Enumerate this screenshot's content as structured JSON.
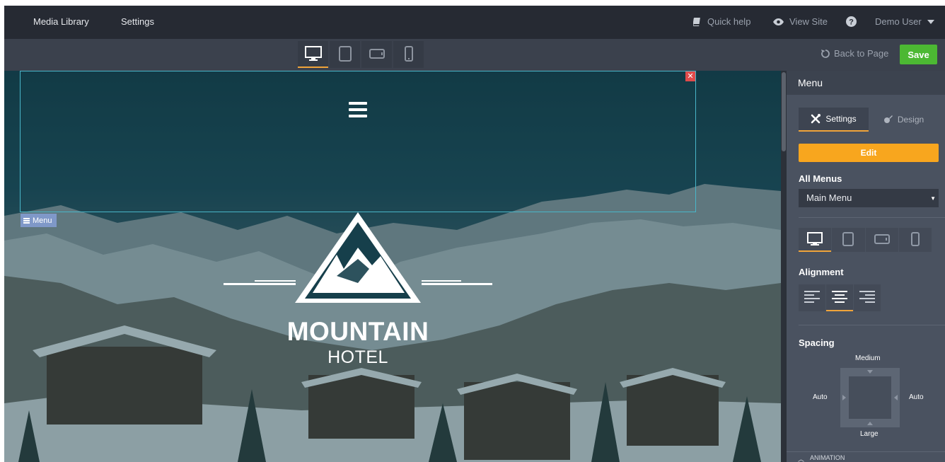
{
  "topbar": {
    "nav": [
      {
        "label": "Media Library"
      },
      {
        "label": "Settings"
      }
    ],
    "quick_help": "Quick help",
    "view_site": "View Site",
    "user": "Demo User"
  },
  "toolbar": {
    "devices": [
      "desktop",
      "tablet",
      "tablet-landscape",
      "phone"
    ],
    "active_device": "desktop",
    "back_label": "Back to Page",
    "save_label": "Save"
  },
  "canvas": {
    "menu_tag": "Menu",
    "close_symbol": "✕",
    "logo_title": "MOUNTAIN",
    "logo_subtitle": "HOTEL"
  },
  "panel": {
    "title": "Menu",
    "tabs": [
      {
        "label": "Settings",
        "active": true
      },
      {
        "label": "Design",
        "active": false
      }
    ],
    "edit_label": "Edit",
    "all_menus_label": "All Menus",
    "menu_select_value": "Main Menu",
    "alignment_label": "Alignment",
    "alignment_active": "center",
    "spacing": {
      "label": "Spacing",
      "top": "Medium",
      "left": "Auto",
      "right": "Auto",
      "bottom": "Large"
    },
    "animation_label": "ANIMATION"
  },
  "colors": {
    "accent": "#f0a43a",
    "save": "#4cb833",
    "edit": "#f8a61e",
    "selection": "#49b6c9",
    "close": "#e04b4b"
  }
}
